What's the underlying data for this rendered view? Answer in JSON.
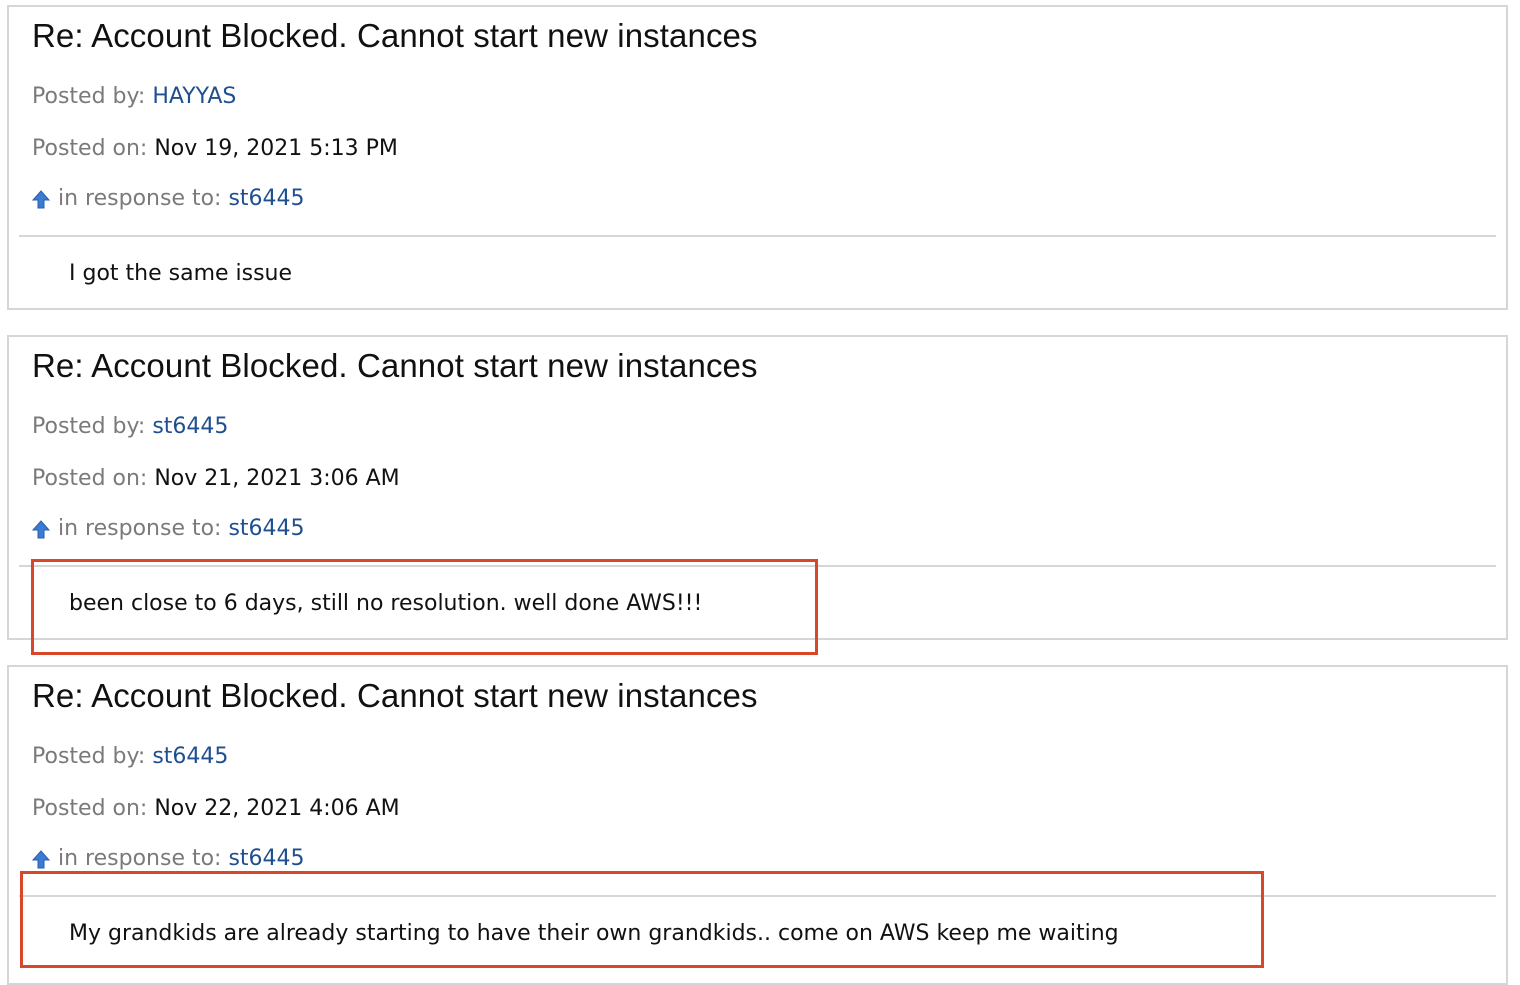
{
  "posts": [
    {
      "title": "Re: Account Blocked. Cannot start new instances",
      "posted_by_label": "Posted by:",
      "posted_by": "HAYYAS",
      "posted_on_label": "Posted on:",
      "posted_on": "Nov 19, 2021 5:13 PM",
      "response_label": "in response to:",
      "response_to": "st6445",
      "body": "I got the same issue"
    },
    {
      "title": "Re: Account Blocked. Cannot start new instances",
      "posted_by_label": "Posted by:",
      "posted_by": "st6445",
      "posted_on_label": "Posted on:",
      "posted_on": "Nov 21, 2021 3:06 AM",
      "response_label": "in response to:",
      "response_to": "st6445",
      "body": "been close to 6 days, still no resolution. well done AWS!!!"
    },
    {
      "title": "Re: Account Blocked. Cannot start new instances",
      "posted_by_label": "Posted by:",
      "posted_by": "st6445",
      "posted_on_label": "Posted on:",
      "posted_on": "Nov 22, 2021 4:06 AM",
      "response_label": "in response to:",
      "response_to": "st6445",
      "body": "My grandkids are already starting to have their own grandkids.. come on AWS keep me waiting"
    }
  ],
  "colors": {
    "link": "#1f4f8f",
    "label": "#7a7a7a",
    "border": "#d6d6d6",
    "highlight": "#d9472b",
    "arrow": "#3a7bd5"
  },
  "icons": {
    "response": "up-arrow-icon"
  }
}
